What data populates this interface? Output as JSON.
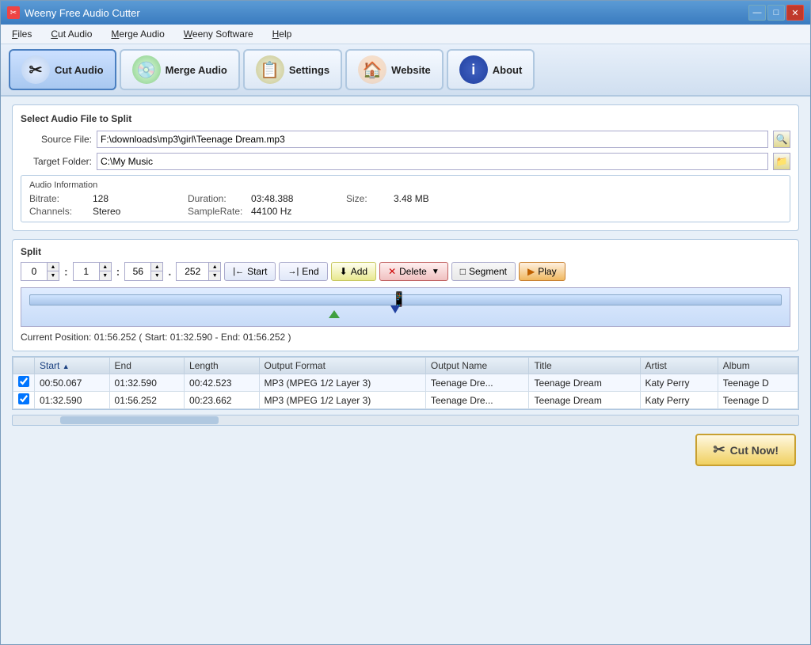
{
  "window": {
    "title": "Weeny Free Audio Cutter",
    "title_icon": "✂"
  },
  "menu": {
    "items": [
      {
        "label": "Files",
        "underline": "F"
      },
      {
        "label": "Cut Audio",
        "underline": "C"
      },
      {
        "label": "Merge Audio",
        "underline": "M"
      },
      {
        "label": "Weeny Software",
        "underline": "W"
      },
      {
        "label": "Help",
        "underline": "H"
      }
    ]
  },
  "toolbar": {
    "buttons": [
      {
        "id": "cut-audio",
        "label": "Cut Audio",
        "icon": "✂",
        "active": true
      },
      {
        "id": "merge-audio",
        "label": "Merge Audio",
        "icon": "💿",
        "active": false
      },
      {
        "id": "settings",
        "label": "Settings",
        "icon": "📋",
        "active": false
      },
      {
        "id": "website",
        "label": "Website",
        "icon": "🏠",
        "active": false
      },
      {
        "id": "about",
        "label": "About",
        "icon": "ℹ",
        "active": false
      }
    ]
  },
  "source_file": {
    "label": "Source File:",
    "value": "F:\\downloads\\mp3\\girl\\Teenage Dream.mp3",
    "browse_icon": "🔍"
  },
  "target_folder": {
    "label": "Target Folder:",
    "value": "C:\\My Music",
    "browse_icon": "📁"
  },
  "audio_info": {
    "section_title": "Audio Information",
    "bitrate_label": "Bitrate:",
    "bitrate_value": "128",
    "channels_label": "Channels:",
    "channels_value": "Stereo",
    "duration_label": "Duration:",
    "duration_value": "03:48.388",
    "samplerate_label": "SampleRate:",
    "samplerate_value": "44100 Hz",
    "size_label": "Size:",
    "size_value": "3.48 MB"
  },
  "split": {
    "section_title": "Split",
    "time_h": "0",
    "time_m": "1",
    "time_s": "56",
    "time_ms": "252",
    "start_label": "Start",
    "end_label": "End",
    "add_label": "Add",
    "delete_label": "Delete",
    "segment_label": "Segment",
    "play_label": "Play",
    "position_text": "Current Position: 01:56.252 ( Start: 01:32.590 - End: 01:56.252 )"
  },
  "table": {
    "columns": [
      "",
      "Start",
      "",
      "End",
      "Length",
      "Output Format",
      "Output Name",
      "Title",
      "Artist",
      "Album"
    ],
    "rows": [
      {
        "checked": true,
        "start": "00:50.067",
        "end": "01:32.590",
        "length": "00:42.523",
        "format": "MP3 (MPEG 1/2 Layer 3)",
        "output_name": "Teenage Dre...",
        "title": "Teenage Dream",
        "artist": "Katy Perry",
        "album": "Teenage D"
      },
      {
        "checked": true,
        "start": "01:32.590",
        "end": "01:56.252",
        "length": "00:23.662",
        "format": "MP3 (MPEG 1/2 Layer 3)",
        "output_name": "Teenage Dre...",
        "title": "Teenage Dream",
        "artist": "Katy Perry",
        "album": "Teenage D"
      }
    ]
  },
  "cut_now_button": "Cut Now!",
  "select_section_title": "Select Audio File to Split"
}
